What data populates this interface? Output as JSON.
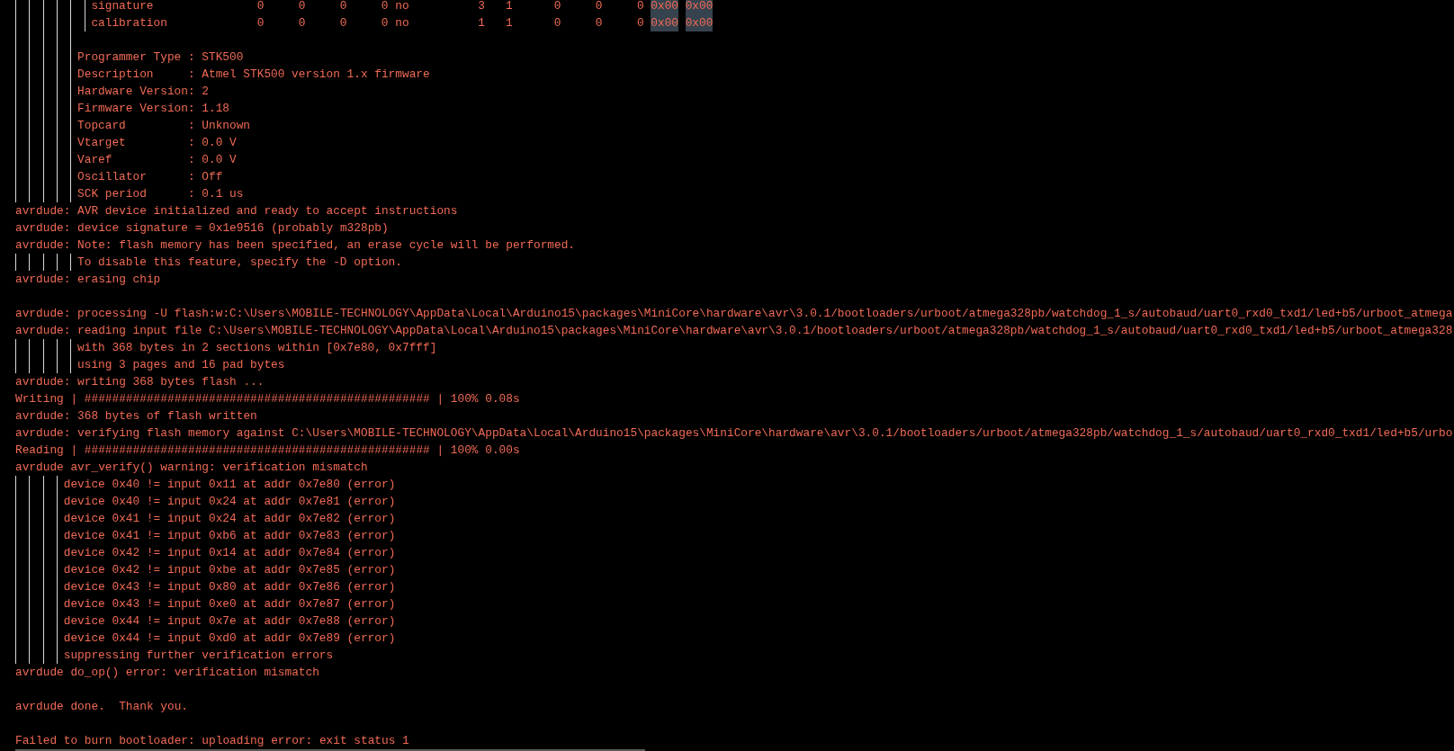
{
  "console": {
    "lines": [
      {
        "kind": "group",
        "children": [
          {
            "kind": "group",
            "children": [
              {
                "kind": "group",
                "children": [
                  {
                    "kind": "group",
                    "children": [
                      {
                        "kind": "group",
                        "children": [
                          {
                            "kind": "group",
                            "children": [
                              {
                                "kind": "table_row",
                                "cells": [
                                  {
                                    "text": "signature",
                                    "highlighted": false
                                  },
                                  {
                                    "text": "0",
                                    "highlighted": false
                                  },
                                  {
                                    "text": "0",
                                    "highlighted": false
                                  },
                                  {
                                    "text": "0",
                                    "highlighted": false
                                  },
                                  {
                                    "text": "0",
                                    "highlighted": false
                                  },
                                  {
                                    "text": "no",
                                    "highlighted": false
                                  },
                                  {
                                    "text": "3",
                                    "highlighted": false
                                  },
                                  {
                                    "text": "1",
                                    "highlighted": false
                                  },
                                  {
                                    "text": "0",
                                    "highlighted": false
                                  },
                                  {
                                    "text": "0",
                                    "highlighted": false
                                  },
                                  {
                                    "text": "0",
                                    "highlighted": false
                                  },
                                  {
                                    "text": "0x00",
                                    "highlighted": true
                                  },
                                  {
                                    "text": "0x00",
                                    "highlighted": true
                                  }
                                ]
                              },
                              {
                                "kind": "table_row",
                                "cells": [
                                  {
                                    "text": "calibration",
                                    "highlighted": false
                                  },
                                  {
                                    "text": "0",
                                    "highlighted": false
                                  },
                                  {
                                    "text": "0",
                                    "highlighted": false
                                  },
                                  {
                                    "text": "0",
                                    "highlighted": false
                                  },
                                  {
                                    "text": "0",
                                    "highlighted": false
                                  },
                                  {
                                    "text": "no",
                                    "highlighted": false
                                  },
                                  {
                                    "text": "1",
                                    "highlighted": false
                                  },
                                  {
                                    "text": "1",
                                    "highlighted": false
                                  },
                                  {
                                    "text": "0",
                                    "highlighted": false
                                  },
                                  {
                                    "text": "0",
                                    "highlighted": false
                                  },
                                  {
                                    "text": "0",
                                    "highlighted": false
                                  },
                                  {
                                    "text": "0x00",
                                    "highlighted": true
                                  },
                                  {
                                    "text": "0x00",
                                    "highlighted": true
                                  }
                                ]
                              }
                            ]
                          },
                          {
                            "kind": "blank"
                          },
                          {
                            "kind": "text",
                            "text": "Programmer Type : STK500"
                          },
                          {
                            "kind": "text",
                            "text": "Description     : Atmel STK500 version 1.x firmware"
                          },
                          {
                            "kind": "text",
                            "text": "Hardware Version: 2"
                          },
                          {
                            "kind": "text",
                            "text": "Firmware Version: 1.18"
                          },
                          {
                            "kind": "text",
                            "text": "Topcard         : Unknown"
                          },
                          {
                            "kind": "text",
                            "text": "Vtarget         : 0.0 V"
                          },
                          {
                            "kind": "text",
                            "text": "Varef           : 0.0 V"
                          },
                          {
                            "kind": "text",
                            "text": "Oscillator      : Off"
                          },
                          {
                            "kind": "text",
                            "text": "SCK period      : 0.1 us"
                          }
                        ]
                      }
                    ]
                  }
                ]
              }
            ]
          }
        ]
      },
      {
        "kind": "text",
        "text": "avrdude: AVR device initialized and ready to accept instructions"
      },
      {
        "kind": "text",
        "text": "avrdude: device signature = 0x1e9516 (probably m328pb)"
      },
      {
        "kind": "text",
        "text": "avrdude: Note: flash memory has been specified, an erase cycle will be performed."
      },
      {
        "kind": "group",
        "children": [
          {
            "kind": "group",
            "children": [
              {
                "kind": "group",
                "children": [
                  {
                    "kind": "group",
                    "children": [
                      {
                        "kind": "group",
                        "children": [
                          {
                            "kind": "text",
                            "text": "To disable this feature, specify the -D option."
                          }
                        ]
                      }
                    ]
                  }
                ]
              }
            ]
          }
        ]
      },
      {
        "kind": "text",
        "text": "avrdude: erasing chip"
      },
      {
        "kind": "blank"
      },
      {
        "kind": "text",
        "text": "avrdude: processing -U flash:w:C:\\Users\\MOBILE-TECHNOLOGY\\AppData\\Local\\Arduino15\\packages\\MiniCore\\hardware\\avr\\3.0.1/bootloaders/urboot/atmega328pb/watchdog_1_s/autobaud/uart0_rxd0_txd1/led+b5/urboot_atmega"
      },
      {
        "kind": "text",
        "text": "avrdude: reading input file C:\\Users\\MOBILE-TECHNOLOGY\\AppData\\Local\\Arduino15\\packages\\MiniCore\\hardware\\avr\\3.0.1/bootloaders/urboot/atmega328pb/watchdog_1_s/autobaud/uart0_rxd0_txd1/led+b5/urboot_atmega328"
      },
      {
        "kind": "group",
        "children": [
          {
            "kind": "group",
            "children": [
              {
                "kind": "group",
                "children": [
                  {
                    "kind": "group",
                    "children": [
                      {
                        "kind": "group",
                        "children": [
                          {
                            "kind": "text",
                            "text": "with 368 bytes in 2 sections within [0x7e80, 0x7fff]"
                          },
                          {
                            "kind": "text",
                            "text": "using 3 pages and 16 pad bytes"
                          }
                        ]
                      }
                    ]
                  }
                ]
              }
            ]
          }
        ]
      },
      {
        "kind": "text",
        "text": "avrdude: writing 368 bytes flash ..."
      },
      {
        "kind": "text",
        "text": "Writing | ################################################## | 100% 0.08s"
      },
      {
        "kind": "text",
        "text": "avrdude: 368 bytes of flash written"
      },
      {
        "kind": "text",
        "text": "avrdude: verifying flash memory against C:\\Users\\MOBILE-TECHNOLOGY\\AppData\\Local\\Arduino15\\packages\\MiniCore\\hardware\\avr\\3.0.1/bootloaders/urboot/atmega328pb/watchdog_1_s/autobaud/uart0_rxd0_txd1/led+b5/urbo"
      },
      {
        "kind": "text",
        "text": "Reading | ################################################## | 100% 0.00s"
      },
      {
        "kind": "text",
        "text": "avrdude avr_verify() warning: verification mismatch"
      },
      {
        "kind": "group",
        "children": [
          {
            "kind": "group",
            "children": [
              {
                "kind": "group",
                "children": [
                  {
                    "kind": "group",
                    "children": [
                      {
                        "kind": "text",
                        "text": "device 0x40 != input 0x11 at addr 0x7e80 (error)"
                      },
                      {
                        "kind": "text",
                        "text": "device 0x40 != input 0x24 at addr 0x7e81 (error)"
                      },
                      {
                        "kind": "text",
                        "text": "device 0x41 != input 0x24 at addr 0x7e82 (error)"
                      },
                      {
                        "kind": "text",
                        "text": "device 0x41 != input 0xb6 at addr 0x7e83 (error)"
                      },
                      {
                        "kind": "text",
                        "text": "device 0x42 != input 0x14 at addr 0x7e84 (error)"
                      },
                      {
                        "kind": "text",
                        "text": "device 0x42 != input 0xbe at addr 0x7e85 (error)"
                      },
                      {
                        "kind": "text",
                        "text": "device 0x43 != input 0x80 at addr 0x7e86 (error)"
                      },
                      {
                        "kind": "text",
                        "text": "device 0x43 != input 0xe0 at addr 0x7e87 (error)"
                      },
                      {
                        "kind": "text",
                        "text": "device 0x44 != input 0x7e at addr 0x7e88 (error)"
                      },
                      {
                        "kind": "text",
                        "text": "device 0x44 != input 0xd0 at addr 0x7e89 (error)"
                      },
                      {
                        "kind": "text",
                        "text": "suppressing further verification errors"
                      }
                    ]
                  }
                ]
              }
            ]
          }
        ]
      },
      {
        "kind": "text",
        "text": "avrdude do_op() error: verification mismatch"
      },
      {
        "kind": "blank"
      },
      {
        "kind": "text",
        "text": "avrdude done.  Thank you."
      },
      {
        "kind": "blank"
      },
      {
        "kind": "text",
        "text": "Failed to burn bootloader: uploading error: exit status 1"
      }
    ]
  }
}
